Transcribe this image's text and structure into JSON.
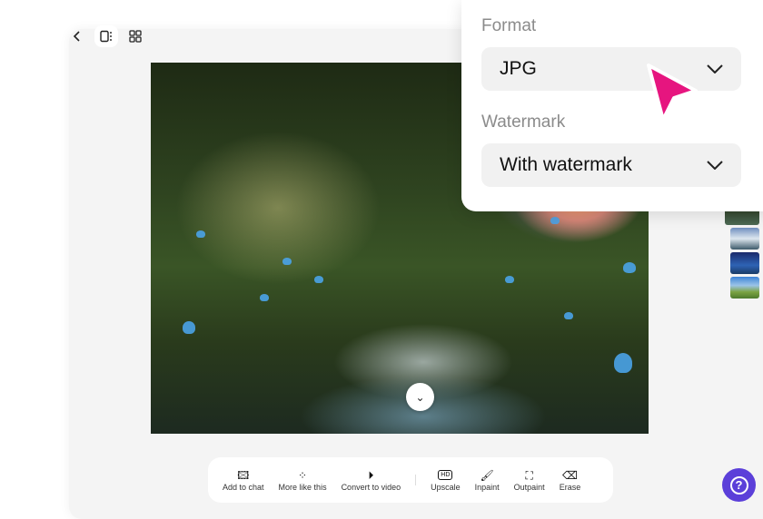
{
  "toolbar": {
    "items": [
      {
        "label": "Add to chat",
        "icon": "image-add-icon"
      },
      {
        "label": "More like this",
        "icon": "variations-icon"
      },
      {
        "label": "Convert to video",
        "icon": "play-icon"
      },
      {
        "label": "Upscale",
        "icon": "hd-icon"
      },
      {
        "label": "Inpaint",
        "icon": "brush-icon"
      },
      {
        "label": "Outpaint",
        "icon": "expand-icon"
      },
      {
        "label": "Erase",
        "icon": "eraser-icon"
      }
    ]
  },
  "popup": {
    "format_label": "Format",
    "format_value": "JPG",
    "watermark_label": "Watermark",
    "watermark_value": "With watermark"
  },
  "colors": {
    "accent": "#5b3fd9",
    "cursor": "#e6157f"
  }
}
